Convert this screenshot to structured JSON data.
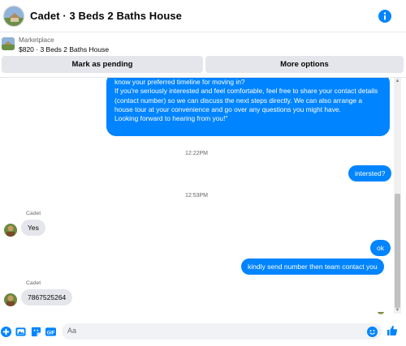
{
  "header": {
    "title": "Cadet · 3 Beds 2 Baths House"
  },
  "listing": {
    "label": "Marketplace",
    "price_title": "$820 · 3 Beds 2 Baths House"
  },
  "actions": {
    "pending_label": "Mark as pending",
    "options_label": "More options"
  },
  "messages": {
    "outgoing_long": [
      "know your preferred timeline for moving in?",
      "If you're seriously interested and feel comfortable, feel free to share your contact details (contact number) so we can discuss the next steps directly. We can also arrange a house tour at your convenience and go over any questions you might have.",
      "Looking forward to hearing from you!\""
    ],
    "time_1": "12:22PM",
    "out_1": "intersted?",
    "time_2": "12:53PM",
    "sender_1": "Cadet",
    "in_1": "Yes",
    "out_2": "ok",
    "out_3": "kindly send number then team contact you",
    "sender_2": "Cadet",
    "in_2": "7867525264"
  },
  "composer": {
    "placeholder": "Aa"
  },
  "colors": {
    "accent": "#0084ff",
    "incoming_bg": "#e4e6eb"
  }
}
